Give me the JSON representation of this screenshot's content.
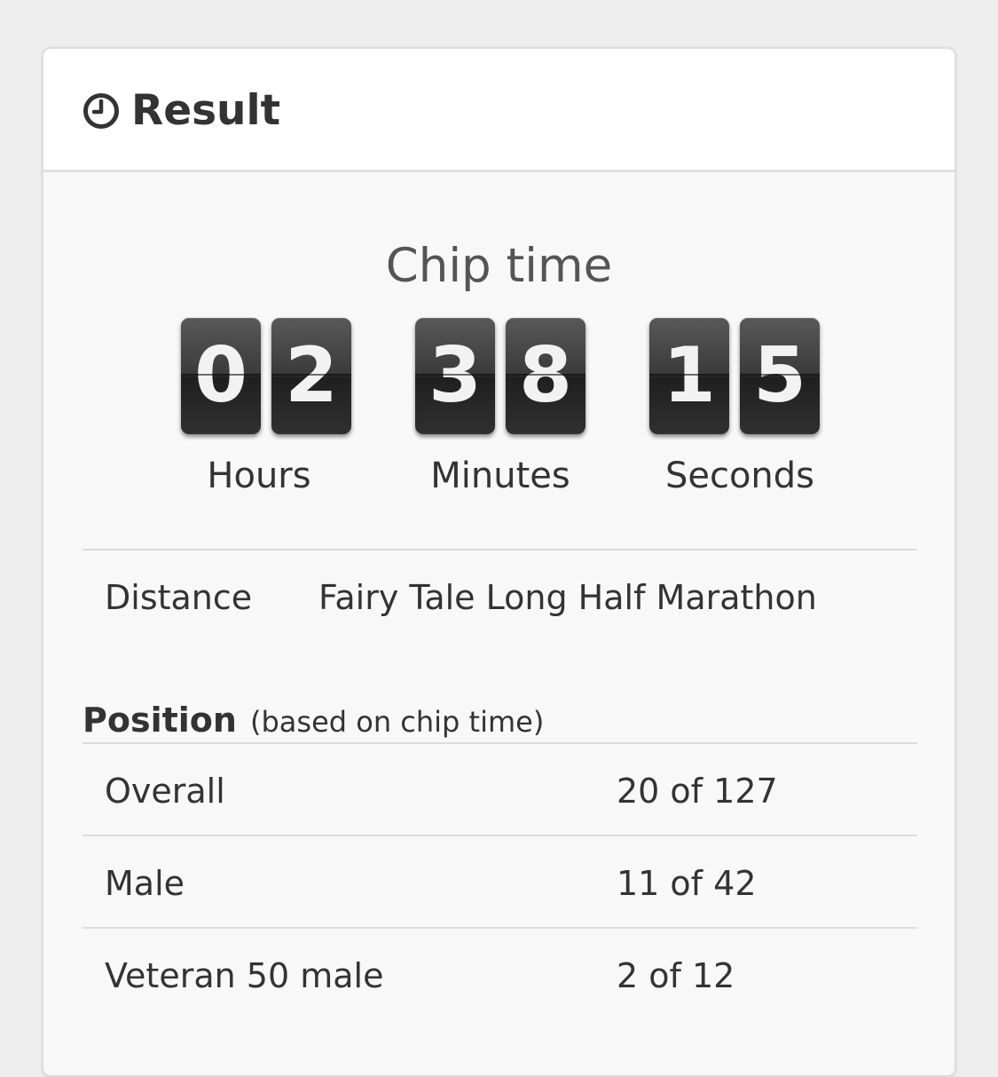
{
  "header": {
    "icon": "clock-icon",
    "title": "Result"
  },
  "chip_time": {
    "title": "Chip time",
    "hours": {
      "d1": "0",
      "d2": "2",
      "label": "Hours"
    },
    "minutes": {
      "d1": "3",
      "d2": "8",
      "label": "Minutes"
    },
    "seconds": {
      "d1": "1",
      "d2": "5",
      "label": "Seconds"
    }
  },
  "distance": {
    "label": "Distance",
    "value": "Fairy Tale Long Half Marathon"
  },
  "position": {
    "heading": "Position",
    "note": "(based on chip time)",
    "rows": [
      {
        "label": "Overall",
        "value": "20 of 127"
      },
      {
        "label": "Male",
        "value": "11 of 42"
      },
      {
        "label": "Veteran 50 male",
        "value": "2 of 12"
      }
    ]
  },
  "colors": {
    "page_background": "#eeeeee",
    "panel_background": "#f8f8f8",
    "header_background": "#ffffff",
    "text": "#333333",
    "flip_card": "#333333",
    "flip_digit": "#f2f2f2"
  }
}
